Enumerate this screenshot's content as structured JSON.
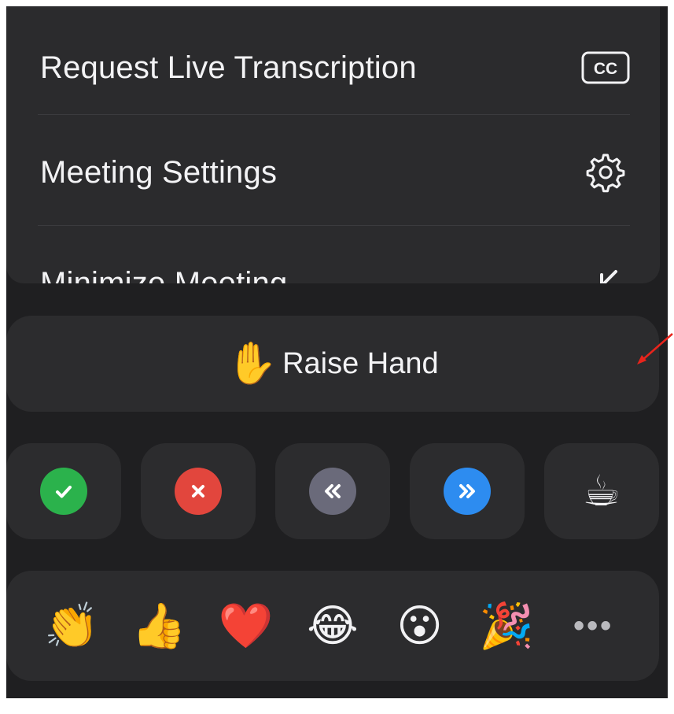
{
  "menu": {
    "items": [
      {
        "label": "Request Live Transcription",
        "icon": "closed-caption-icon"
      },
      {
        "label": "Meeting Settings",
        "icon": "gear-icon"
      },
      {
        "label": "Minimize Meeting",
        "icon": "minimize-arrow-icon"
      }
    ]
  },
  "raise_hand": {
    "emoji": "✋",
    "label": "Raise Hand"
  },
  "feedback": [
    {
      "name": "yes",
      "icon": "check-icon",
      "color": "#2bb24c"
    },
    {
      "name": "no",
      "icon": "x-icon",
      "color": "#e2463d"
    },
    {
      "name": "slow-down",
      "icon": "rewind-icon",
      "color": "#6a6a7a"
    },
    {
      "name": "speed-up",
      "icon": "fast-forward-icon",
      "color": "#2d8cf0"
    },
    {
      "name": "coffee",
      "icon": "coffee-cup-icon",
      "emoji": "☕"
    }
  ],
  "reactions": {
    "items": [
      "👏",
      "👍",
      "❤️",
      "😂",
      "😮",
      "🎉"
    ],
    "more_label": "•••"
  },
  "colors": {
    "background": "#1f1f21",
    "panel": "#2b2b2d",
    "annotation_arrow": "#e8241c"
  }
}
